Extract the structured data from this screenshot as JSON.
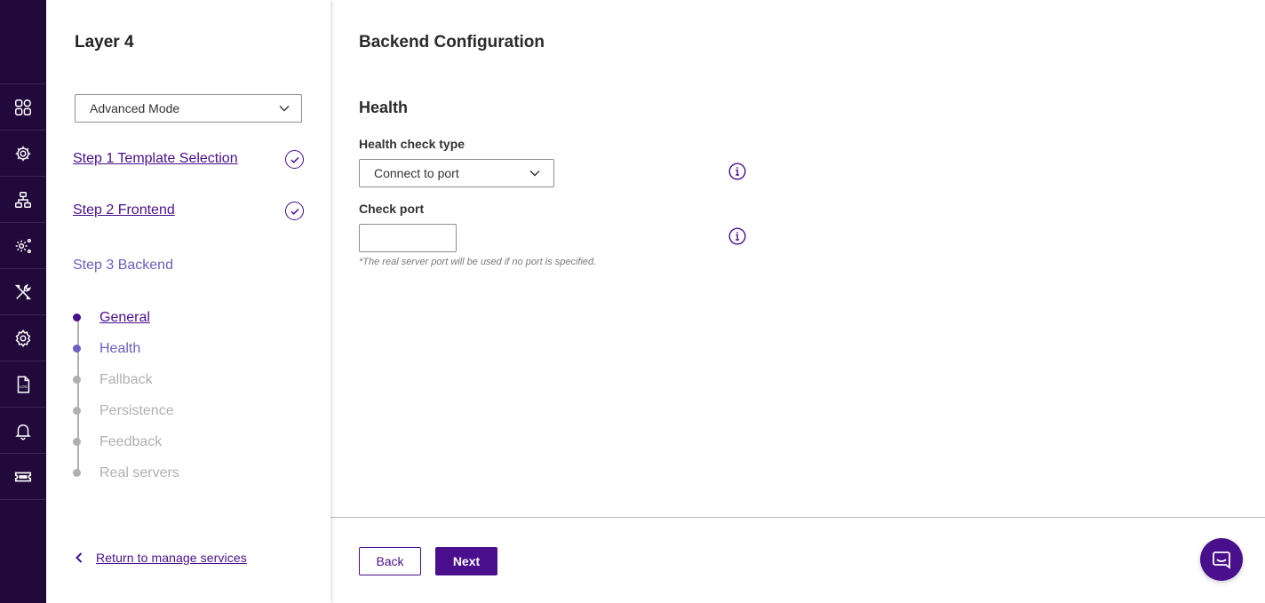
{
  "colors": {
    "rail_bg": "#22093b",
    "accent": "#4a0f8c",
    "current_step": "#6b5fc0",
    "inactive": "#b0b0b0"
  },
  "rail": {
    "items": [
      {
        "icon": "dashboard-icon"
      },
      {
        "icon": "network-settings-icon"
      },
      {
        "icon": "sitemap-icon"
      },
      {
        "icon": "advanced-settings-icon"
      },
      {
        "icon": "tools-icon"
      },
      {
        "icon": "gear-icon"
      },
      {
        "icon": "log-file-icon"
      },
      {
        "icon": "bell-icon"
      },
      {
        "icon": "ticket-icon"
      }
    ]
  },
  "panel": {
    "title": "Layer 4",
    "mode_select": "Advanced Mode",
    "steps": [
      {
        "label": "Step 1 Template Selection",
        "status": "complete"
      },
      {
        "label": "Step 2 Frontend",
        "status": "complete"
      },
      {
        "label": "Step 3 Backend",
        "status": "current"
      }
    ],
    "substeps": [
      {
        "label": "General",
        "state": "done"
      },
      {
        "label": "Health",
        "state": "current"
      },
      {
        "label": "Fallback",
        "state": "pending"
      },
      {
        "label": "Persistence",
        "state": "pending"
      },
      {
        "label": "Feedback",
        "state": "pending"
      },
      {
        "label": "Real servers",
        "state": "pending"
      }
    ],
    "return_link": "Return to manage services"
  },
  "main": {
    "title": "Backend Configuration",
    "section": "Health",
    "health_check_type": {
      "label": "Health check type",
      "value": "Connect to port"
    },
    "check_port": {
      "label": "Check port",
      "value": "",
      "hint": "*The real server port will be used if no port is specified."
    },
    "buttons": {
      "back": "Back",
      "next": "Next"
    }
  }
}
